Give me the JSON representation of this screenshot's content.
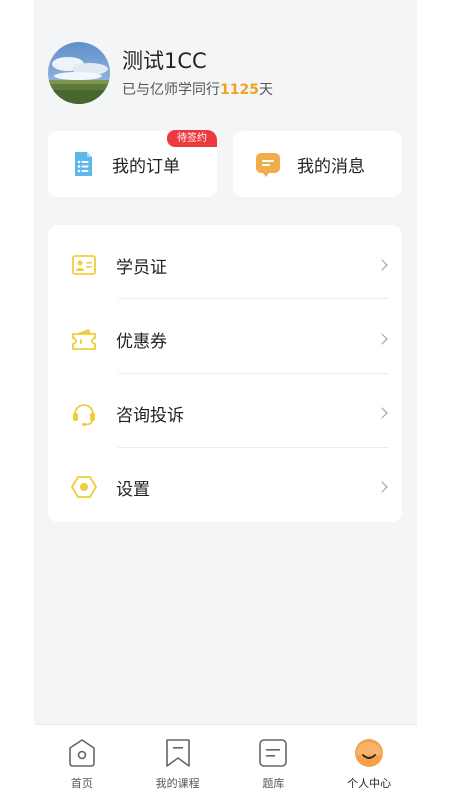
{
  "profile": {
    "name": "测试1CC",
    "companion_prefix": "已与亿师学同行",
    "days": "1125",
    "days_suffix": "天"
  },
  "cards": {
    "orders": {
      "label": "我的订单",
      "badge": "待签约",
      "icon": "document-list-icon"
    },
    "messages": {
      "label": "我的消息",
      "icon": "chat-bubble-icon"
    }
  },
  "menu": [
    {
      "label": "学员证",
      "icon": "id-card-icon"
    },
    {
      "label": "优惠券",
      "icon": "coupon-icon"
    },
    {
      "label": "咨询投诉",
      "icon": "headset-icon"
    },
    {
      "label": "设置",
      "icon": "settings-hex-icon"
    }
  ],
  "tabs": [
    {
      "label": "首页",
      "icon": "home-icon"
    },
    {
      "label": "我的课程",
      "icon": "bookmark-icon"
    },
    {
      "label": "题库",
      "icon": "question-bank-icon"
    },
    {
      "label": "个人中心",
      "icon": "profile-face-icon",
      "active": true
    }
  ],
  "colors": {
    "accent": "#f0a321",
    "badge": "#ec3a3f",
    "menu_icon": "#f2cc3a",
    "orders_icon": "#5bb8ea",
    "messages_icon": "#f0ad4a"
  }
}
